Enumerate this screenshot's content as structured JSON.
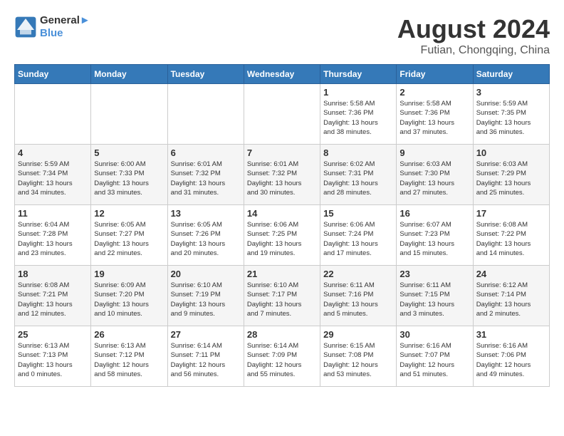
{
  "header": {
    "logo_line1": "General",
    "logo_line2": "Blue",
    "main_title": "August 2024",
    "subtitle": "Futian, Chongqing, China"
  },
  "calendar": {
    "days_of_week": [
      "Sunday",
      "Monday",
      "Tuesday",
      "Wednesday",
      "Thursday",
      "Friday",
      "Saturday"
    ],
    "weeks": [
      [
        {
          "day": "",
          "info": ""
        },
        {
          "day": "",
          "info": ""
        },
        {
          "day": "",
          "info": ""
        },
        {
          "day": "",
          "info": ""
        },
        {
          "day": "1",
          "info": "Sunrise: 5:58 AM\nSunset: 7:36 PM\nDaylight: 13 hours\nand 38 minutes."
        },
        {
          "day": "2",
          "info": "Sunrise: 5:58 AM\nSunset: 7:36 PM\nDaylight: 13 hours\nand 37 minutes."
        },
        {
          "day": "3",
          "info": "Sunrise: 5:59 AM\nSunset: 7:35 PM\nDaylight: 13 hours\nand 36 minutes."
        }
      ],
      [
        {
          "day": "4",
          "info": "Sunrise: 5:59 AM\nSunset: 7:34 PM\nDaylight: 13 hours\nand 34 minutes."
        },
        {
          "day": "5",
          "info": "Sunrise: 6:00 AM\nSunset: 7:33 PM\nDaylight: 13 hours\nand 33 minutes."
        },
        {
          "day": "6",
          "info": "Sunrise: 6:01 AM\nSunset: 7:32 PM\nDaylight: 13 hours\nand 31 minutes."
        },
        {
          "day": "7",
          "info": "Sunrise: 6:01 AM\nSunset: 7:32 PM\nDaylight: 13 hours\nand 30 minutes."
        },
        {
          "day": "8",
          "info": "Sunrise: 6:02 AM\nSunset: 7:31 PM\nDaylight: 13 hours\nand 28 minutes."
        },
        {
          "day": "9",
          "info": "Sunrise: 6:03 AM\nSunset: 7:30 PM\nDaylight: 13 hours\nand 27 minutes."
        },
        {
          "day": "10",
          "info": "Sunrise: 6:03 AM\nSunset: 7:29 PM\nDaylight: 13 hours\nand 25 minutes."
        }
      ],
      [
        {
          "day": "11",
          "info": "Sunrise: 6:04 AM\nSunset: 7:28 PM\nDaylight: 13 hours\nand 23 minutes."
        },
        {
          "day": "12",
          "info": "Sunrise: 6:05 AM\nSunset: 7:27 PM\nDaylight: 13 hours\nand 22 minutes."
        },
        {
          "day": "13",
          "info": "Sunrise: 6:05 AM\nSunset: 7:26 PM\nDaylight: 13 hours\nand 20 minutes."
        },
        {
          "day": "14",
          "info": "Sunrise: 6:06 AM\nSunset: 7:25 PM\nDaylight: 13 hours\nand 19 minutes."
        },
        {
          "day": "15",
          "info": "Sunrise: 6:06 AM\nSunset: 7:24 PM\nDaylight: 13 hours\nand 17 minutes."
        },
        {
          "day": "16",
          "info": "Sunrise: 6:07 AM\nSunset: 7:23 PM\nDaylight: 13 hours\nand 15 minutes."
        },
        {
          "day": "17",
          "info": "Sunrise: 6:08 AM\nSunset: 7:22 PM\nDaylight: 13 hours\nand 14 minutes."
        }
      ],
      [
        {
          "day": "18",
          "info": "Sunrise: 6:08 AM\nSunset: 7:21 PM\nDaylight: 13 hours\nand 12 minutes."
        },
        {
          "day": "19",
          "info": "Sunrise: 6:09 AM\nSunset: 7:20 PM\nDaylight: 13 hours\nand 10 minutes."
        },
        {
          "day": "20",
          "info": "Sunrise: 6:10 AM\nSunset: 7:19 PM\nDaylight: 13 hours\nand 9 minutes."
        },
        {
          "day": "21",
          "info": "Sunrise: 6:10 AM\nSunset: 7:17 PM\nDaylight: 13 hours\nand 7 minutes."
        },
        {
          "day": "22",
          "info": "Sunrise: 6:11 AM\nSunset: 7:16 PM\nDaylight: 13 hours\nand 5 minutes."
        },
        {
          "day": "23",
          "info": "Sunrise: 6:11 AM\nSunset: 7:15 PM\nDaylight: 13 hours\nand 3 minutes."
        },
        {
          "day": "24",
          "info": "Sunrise: 6:12 AM\nSunset: 7:14 PM\nDaylight: 13 hours\nand 2 minutes."
        }
      ],
      [
        {
          "day": "25",
          "info": "Sunrise: 6:13 AM\nSunset: 7:13 PM\nDaylight: 13 hours\nand 0 minutes."
        },
        {
          "day": "26",
          "info": "Sunrise: 6:13 AM\nSunset: 7:12 PM\nDaylight: 12 hours\nand 58 minutes."
        },
        {
          "day": "27",
          "info": "Sunrise: 6:14 AM\nSunset: 7:11 PM\nDaylight: 12 hours\nand 56 minutes."
        },
        {
          "day": "28",
          "info": "Sunrise: 6:14 AM\nSunset: 7:09 PM\nDaylight: 12 hours\nand 55 minutes."
        },
        {
          "day": "29",
          "info": "Sunrise: 6:15 AM\nSunset: 7:08 PM\nDaylight: 12 hours\nand 53 minutes."
        },
        {
          "day": "30",
          "info": "Sunrise: 6:16 AM\nSunset: 7:07 PM\nDaylight: 12 hours\nand 51 minutes."
        },
        {
          "day": "31",
          "info": "Sunrise: 6:16 AM\nSunset: 7:06 PM\nDaylight: 12 hours\nand 49 minutes."
        }
      ]
    ]
  }
}
